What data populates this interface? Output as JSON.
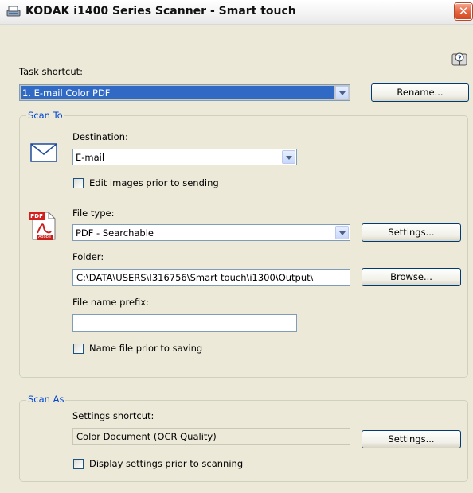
{
  "window": {
    "title": "KODAK i1400 Series Scanner - Smart touch",
    "close_symbol": "✕",
    "icons": {
      "app": "scanner-icon",
      "close": "close-icon",
      "help": "help-icon"
    }
  },
  "task_shortcut": {
    "label": "Task shortcut:",
    "selected": "1. E-mail Color PDF",
    "rename_label": "Rename..."
  },
  "scan_to": {
    "group_title": "Scan To",
    "destination_label": "Destination:",
    "destination_value": "E-mail",
    "destination_icon": "envelope-icon",
    "edit_images_label": "Edit images prior to sending",
    "edit_images_checked": false,
    "file_type_label": "File type:",
    "file_type_value": "PDF - Searchable",
    "file_type_icon": "pdf-file-icon",
    "pdf_icon_text": "PDF",
    "pdf_icon_brand": "Adobe",
    "settings_label": "Settings...",
    "folder_label": "Folder:",
    "folder_value": "C:\\DATA\\USERS\\I316756\\Smart touch\\i1300\\Output\\",
    "browse_label": "Browse...",
    "prefix_label": "File name prefix:",
    "prefix_value": "",
    "name_file_label": "Name file prior to saving",
    "name_file_checked": false
  },
  "scan_as": {
    "group_title": "Scan As",
    "settings_shortcut_label": "Settings shortcut:",
    "settings_shortcut_value": "Color Document (OCR Quality)",
    "settings_label": "Settings...",
    "display_settings_label": "Display settings prior to scanning",
    "display_settings_checked": false
  }
}
